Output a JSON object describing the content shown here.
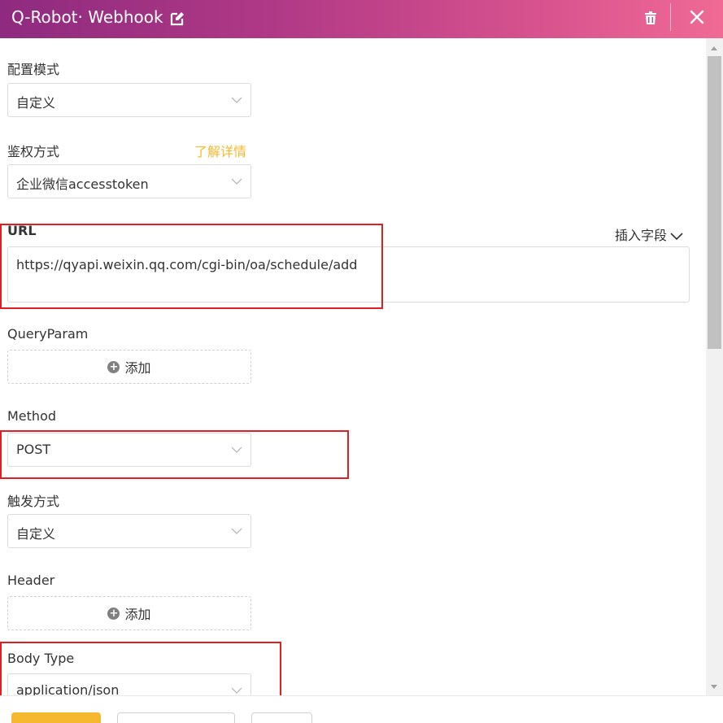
{
  "header": {
    "title": "Q-Robot· Webhook",
    "edit_icon": "edit-icon",
    "delete_icon": "trash-icon",
    "close_icon": "close-icon",
    "gradient_from": "#8e2a7f",
    "gradient_to": "#f06a95"
  },
  "form": {
    "config_mode": {
      "label": "配置模式",
      "value": "自定义"
    },
    "auth_method": {
      "label": "鉴权方式",
      "value": "企业微信accesstoken",
      "link": "了解详情"
    },
    "url": {
      "label": "URL",
      "insert_field": "插入字段",
      "value": "https://qyapi.weixin.qq.com/cgi-bin/oa/schedule/add"
    },
    "query_param": {
      "label": "QueryParam",
      "add_label": "添加"
    },
    "method": {
      "label": "Method",
      "value": "POST"
    },
    "trigger": {
      "label": "触发方式",
      "value": "自定义"
    },
    "header": {
      "label": "Header",
      "add_label": "添加"
    },
    "body_type": {
      "label": "Body Type",
      "value": "application/json"
    }
  },
  "colors": {
    "accent": "#f5b82e",
    "highlight": "#e02020"
  }
}
